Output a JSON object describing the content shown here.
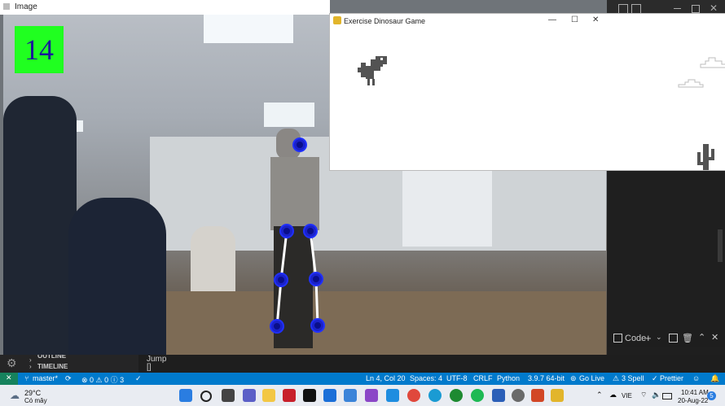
{
  "camera_window": {
    "title": "Image",
    "score": "14"
  },
  "game_window": {
    "title": "Exercise Dinosaur Game"
  },
  "vscode": {
    "panel": {
      "tab_label": "Code"
    },
    "sidebar": {
      "outline_label": "OUTLINE",
      "timeline_label": "TIMELINE"
    },
    "terminal": {
      "output_line": "Jump",
      "prompt": "[]"
    },
    "status_bar": {
      "branch": "master*",
      "problems": "⊗ 0 ⚠ 0 ⓘ 3",
      "cursor": "Ln 4, Col 20",
      "spaces": "Spaces: 4",
      "encoding": "UTF-8",
      "eol": "CRLF",
      "language": "Python",
      "interpreter": "3.9.7 64-bit",
      "go_live": "Go Live",
      "spell": "3 Spell",
      "prettier": "Prettier"
    }
  },
  "taskbar": {
    "weather_temp": "29°C",
    "weather_desc": "Có mây",
    "language": "VIE",
    "time": "10:41 AM",
    "date": "20-Aug-22",
    "notification_count": "5"
  }
}
